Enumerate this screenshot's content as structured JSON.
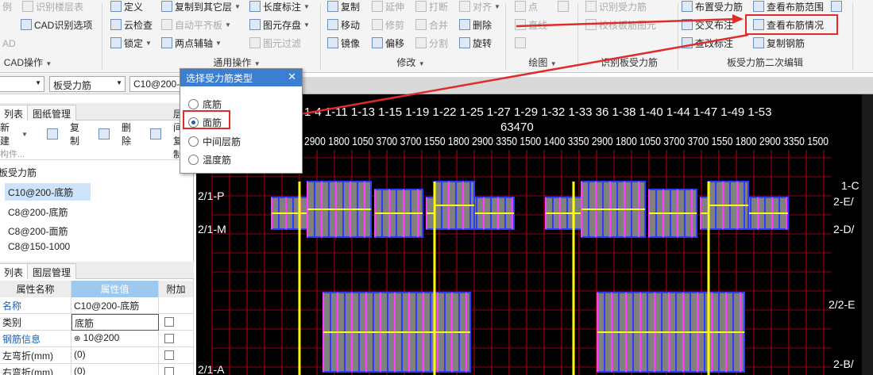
{
  "ribbon": {
    "col0": [
      "识别楼层表",
      "CAD识别选项",
      "CAD"
    ],
    "col0_left": [
      "例",
      "AD"
    ],
    "col1": [
      "定义",
      "云检查",
      "锁定"
    ],
    "col2": [
      "复制到其它层",
      "自动平齐板",
      "两点辅轴"
    ],
    "col3": [
      "长度标注",
      "图元存盘",
      "图元过滤"
    ],
    "col4": [
      "复制",
      "移动",
      "镜像"
    ],
    "col5": [
      "延伸",
      "修剪",
      "偏移"
    ],
    "col6": [
      "打断",
      "合并",
      "分割"
    ],
    "col7": [
      "对齐",
      "删除",
      "旋转"
    ],
    "col8": [
      "点",
      "直线"
    ],
    "col9": [
      "识别受力筋",
      "校核板筋图元"
    ],
    "col10": [
      "布置受力筋",
      "交叉布注",
      "查改标注"
    ],
    "col11": [
      "查看布筋范围",
      "查看布筋情况",
      "复制钢筋"
    ],
    "groups": {
      "cad": "CAD操作",
      "common": "通用操作",
      "modify": "修改",
      "draw": "绘图",
      "recog": "识别板受力筋",
      "edit2": "板受力筋二次编辑"
    }
  },
  "toolbar2": {
    "combo1": "",
    "combo2": "板受力筋",
    "combo3": "C10@200-"
  },
  "component_panel": {
    "tabs": [
      "列表",
      "图纸管理"
    ],
    "actions": [
      "新建",
      "复制",
      "删除",
      "层间复制"
    ],
    "search_placeholder": "构件...",
    "category": "板受力筋",
    "items": [
      "C10@200-底筋",
      "C8@200-底筋",
      "C8@200-面筋",
      "C8@150-1000"
    ]
  },
  "property_panel": {
    "tabs": [
      "列表",
      "图层管理"
    ],
    "headers": {
      "name": "属性名称",
      "value": "属性值",
      "extra": "附加"
    },
    "rows": [
      {
        "name": "名称",
        "value": "C10@200-底筋",
        "blue": true
      },
      {
        "name": "类别",
        "value": "底筋",
        "blue": false
      },
      {
        "name": "钢筋信息",
        "value": " 10@200",
        "blue": true
      },
      {
        "name": "左弯折(mm)",
        "value": "(0)",
        "blue": false
      },
      {
        "name": "右弯折(mm)",
        "value": "(0)",
        "blue": false
      }
    ]
  },
  "dialog": {
    "title": "选择受力筋类型",
    "options": [
      "底筋",
      "面筋",
      "中间层筋",
      "温度筋"
    ],
    "selected": "面筋"
  },
  "canvas": {
    "axis_top": "1-4  1-11  1-13  1-15 1-19  1-22 1-25 1-27 1-29 1-32 1-33 36 1-38  1-40 1-44 1-47 1-49 1-53",
    "total_dim": "63470",
    "dims_row": "2900 1800 1050 3700 3700 1550 1800 2900 3350 1500 1400 3350 2900 1800 1050 3700 3700 1550 1800 2900 3350 1500",
    "axis_left": [
      "2/1-P",
      "2/1-M",
      "2/1-A"
    ],
    "axis_right": [
      "1-C",
      "2-E/",
      "2-D/",
      "2/2-E",
      "2-B/"
    ],
    "colors": {
      "bg": "#000000",
      "grid": "#c0001a",
      "rebar_blue": "#2c3cff",
      "rebar_magenta": "#ff3cff",
      "slab": "#808080",
      "beam": "#ffff00"
    }
  }
}
